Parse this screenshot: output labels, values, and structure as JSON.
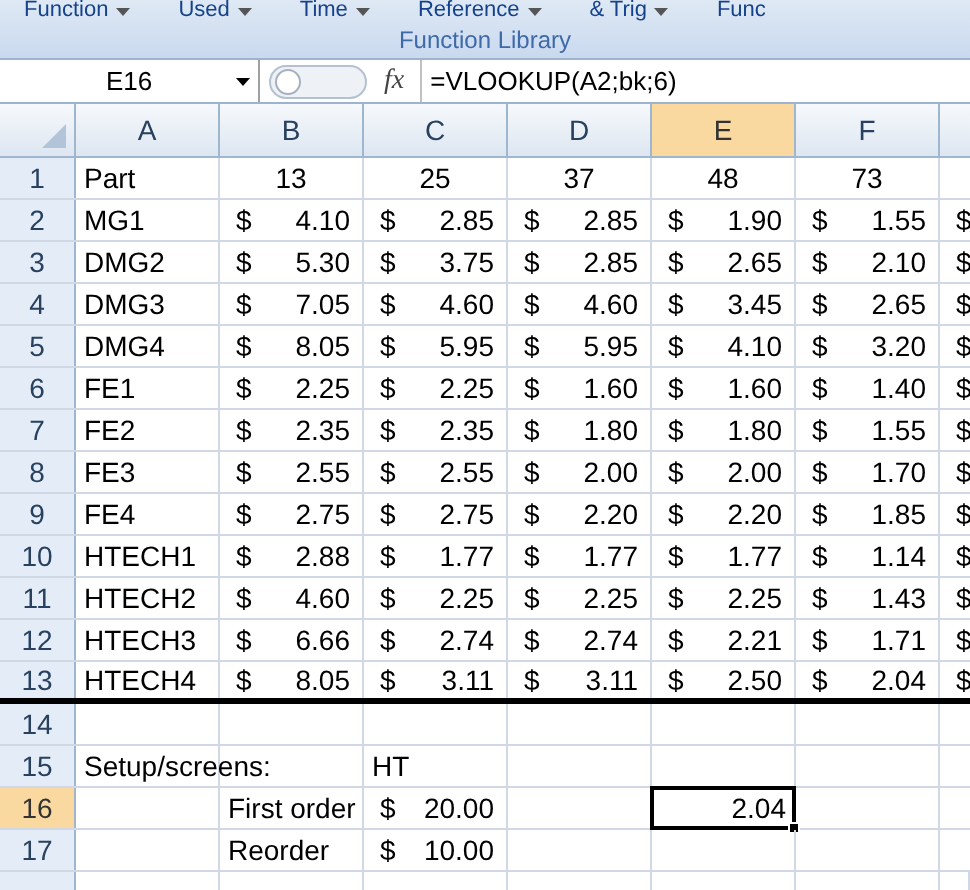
{
  "ribbon": {
    "buttons": [
      {
        "label": "Function",
        "dropdown": true
      },
      {
        "label": "Used",
        "dropdown": true
      },
      {
        "label": "Time",
        "dropdown": true
      },
      {
        "label": "Reference",
        "dropdown": true
      },
      {
        "label": "& Trig",
        "dropdown": true
      },
      {
        "label": "Func",
        "dropdown": false
      }
    ],
    "group_label": "Function Library"
  },
  "formula_bar": {
    "name_box": "E16",
    "fx": "fx",
    "formula": "=VLOOKUP(A2;bk;6)"
  },
  "columns": [
    {
      "label": "A",
      "selected": false
    },
    {
      "label": "B",
      "selected": false
    },
    {
      "label": "C",
      "selected": false
    },
    {
      "label": "D",
      "selected": false
    },
    {
      "label": "E",
      "selected": true
    },
    {
      "label": "F",
      "selected": false
    }
  ],
  "rows": [
    {
      "number": "1",
      "selected": false,
      "thick_bottom_border": false,
      "cells": [
        {
          "kind": "text",
          "text": "Part",
          "selected": false
        },
        {
          "kind": "center",
          "text": "13",
          "selected": false
        },
        {
          "kind": "center",
          "text": "25",
          "selected": false
        },
        {
          "kind": "center",
          "text": "37",
          "selected": false
        },
        {
          "kind": "center",
          "text": "48",
          "selected": false
        },
        {
          "kind": "center",
          "text": "73",
          "selected": false
        }
      ]
    },
    {
      "number": "2",
      "selected": false,
      "thick_bottom_border": false,
      "cells": [
        {
          "kind": "text",
          "text": "MG1",
          "selected": false
        },
        {
          "kind": "money",
          "symbol": "$",
          "amount": "4.10",
          "selected": false
        },
        {
          "kind": "money",
          "symbol": "$",
          "amount": "2.85",
          "selected": false
        },
        {
          "kind": "money",
          "symbol": "$",
          "amount": "2.85",
          "selected": false
        },
        {
          "kind": "money",
          "symbol": "$",
          "amount": "1.90",
          "selected": false
        },
        {
          "kind": "money",
          "symbol": "$",
          "amount": "1.55",
          "selected": false
        },
        {
          "kind": "money",
          "symbol": "$",
          "selected": false
        }
      ]
    },
    {
      "number": "3",
      "selected": false,
      "thick_bottom_border": false,
      "cells": [
        {
          "kind": "text",
          "text": "DMG2",
          "selected": false
        },
        {
          "kind": "money",
          "symbol": "$",
          "amount": "5.30",
          "selected": false
        },
        {
          "kind": "money",
          "symbol": "$",
          "amount": "3.75",
          "selected": false
        },
        {
          "kind": "money",
          "symbol": "$",
          "amount": "2.85",
          "selected": false
        },
        {
          "kind": "money",
          "symbol": "$",
          "amount": "2.65",
          "selected": false
        },
        {
          "kind": "money",
          "symbol": "$",
          "amount": "2.10",
          "selected": false
        },
        {
          "kind": "money",
          "symbol": "$",
          "selected": false
        }
      ]
    },
    {
      "number": "4",
      "selected": false,
      "thick_bottom_border": false,
      "cells": [
        {
          "kind": "text",
          "text": "DMG3",
          "selected": false
        },
        {
          "kind": "money",
          "symbol": "$",
          "amount": "7.05",
          "selected": false
        },
        {
          "kind": "money",
          "symbol": "$",
          "amount": "4.60",
          "selected": false
        },
        {
          "kind": "money",
          "symbol": "$",
          "amount": "4.60",
          "selected": false
        },
        {
          "kind": "money",
          "symbol": "$",
          "amount": "3.45",
          "selected": false
        },
        {
          "kind": "money",
          "symbol": "$",
          "amount": "2.65",
          "selected": false
        },
        {
          "kind": "money",
          "symbol": "$",
          "selected": false
        }
      ]
    },
    {
      "number": "5",
      "selected": false,
      "thick_bottom_border": false,
      "cells": [
        {
          "kind": "text",
          "text": "DMG4",
          "selected": false
        },
        {
          "kind": "money",
          "symbol": "$",
          "amount": "8.05",
          "selected": false
        },
        {
          "kind": "money",
          "symbol": "$",
          "amount": "5.95",
          "selected": false
        },
        {
          "kind": "money",
          "symbol": "$",
          "amount": "5.95",
          "selected": false
        },
        {
          "kind": "money",
          "symbol": "$",
          "amount": "4.10",
          "selected": false
        },
        {
          "kind": "money",
          "symbol": "$",
          "amount": "3.20",
          "selected": false
        },
        {
          "kind": "money",
          "symbol": "$",
          "selected": false
        }
      ]
    },
    {
      "number": "6",
      "selected": false,
      "thick_bottom_border": false,
      "cells": [
        {
          "kind": "text",
          "text": "FE1",
          "selected": false
        },
        {
          "kind": "money",
          "symbol": "$",
          "amount": "2.25",
          "selected": false
        },
        {
          "kind": "money",
          "symbol": "$",
          "amount": "2.25",
          "selected": false
        },
        {
          "kind": "money",
          "symbol": "$",
          "amount": "1.60",
          "selected": false
        },
        {
          "kind": "money",
          "symbol": "$",
          "amount": "1.60",
          "selected": false
        },
        {
          "kind": "money",
          "symbol": "$",
          "amount": "1.40",
          "selected": false
        },
        {
          "kind": "money",
          "symbol": "$",
          "selected": false
        }
      ]
    },
    {
      "number": "7",
      "selected": false,
      "thick_bottom_border": false,
      "cells": [
        {
          "kind": "text",
          "text": "FE2",
          "selected": false
        },
        {
          "kind": "money",
          "symbol": "$",
          "amount": "2.35",
          "selected": false
        },
        {
          "kind": "money",
          "symbol": "$",
          "amount": "2.35",
          "selected": false
        },
        {
          "kind": "money",
          "symbol": "$",
          "amount": "1.80",
          "selected": false
        },
        {
          "kind": "money",
          "symbol": "$",
          "amount": "1.80",
          "selected": false
        },
        {
          "kind": "money",
          "symbol": "$",
          "amount": "1.55",
          "selected": false
        },
        {
          "kind": "money",
          "symbol": "$",
          "selected": false
        }
      ]
    },
    {
      "number": "8",
      "selected": false,
      "thick_bottom_border": false,
      "cells": [
        {
          "kind": "text",
          "text": "FE3",
          "selected": false
        },
        {
          "kind": "money",
          "symbol": "$",
          "amount": "2.55",
          "selected": false
        },
        {
          "kind": "money",
          "symbol": "$",
          "amount": "2.55",
          "selected": false
        },
        {
          "kind": "money",
          "symbol": "$",
          "amount": "2.00",
          "selected": false
        },
        {
          "kind": "money",
          "symbol": "$",
          "amount": "2.00",
          "selected": false
        },
        {
          "kind": "money",
          "symbol": "$",
          "amount": "1.70",
          "selected": false
        },
        {
          "kind": "money",
          "symbol": "$",
          "selected": false
        }
      ]
    },
    {
      "number": "9",
      "selected": false,
      "thick_bottom_border": false,
      "cells": [
        {
          "kind": "text",
          "text": "FE4",
          "selected": false
        },
        {
          "kind": "money",
          "symbol": "$",
          "amount": "2.75",
          "selected": false
        },
        {
          "kind": "money",
          "symbol": "$",
          "amount": "2.75",
          "selected": false
        },
        {
          "kind": "money",
          "symbol": "$",
          "amount": "2.20",
          "selected": false
        },
        {
          "kind": "money",
          "symbol": "$",
          "amount": "2.20",
          "selected": false
        },
        {
          "kind": "money",
          "symbol": "$",
          "amount": "1.85",
          "selected": false
        },
        {
          "kind": "money",
          "symbol": "$",
          "selected": false
        }
      ]
    },
    {
      "number": "10",
      "selected": false,
      "thick_bottom_border": false,
      "cells": [
        {
          "kind": "text",
          "text": "HTECH1",
          "selected": false
        },
        {
          "kind": "money",
          "symbol": "$",
          "amount": "2.88",
          "selected": false
        },
        {
          "kind": "money",
          "symbol": "$",
          "amount": "1.77",
          "selected": false
        },
        {
          "kind": "money",
          "symbol": "$",
          "amount": "1.77",
          "selected": false
        },
        {
          "kind": "money",
          "symbol": "$",
          "amount": "1.77",
          "selected": false
        },
        {
          "kind": "money",
          "symbol": "$",
          "amount": "1.14",
          "selected": false
        },
        {
          "kind": "money",
          "symbol": "$",
          "selected": false
        }
      ]
    },
    {
      "number": "11",
      "selected": false,
      "thick_bottom_border": false,
      "cells": [
        {
          "kind": "text",
          "text": "HTECH2",
          "selected": false
        },
        {
          "kind": "money",
          "symbol": "$",
          "amount": "4.60",
          "selected": false
        },
        {
          "kind": "money",
          "symbol": "$",
          "amount": "2.25",
          "selected": false
        },
        {
          "kind": "money",
          "symbol": "$",
          "amount": "2.25",
          "selected": false
        },
        {
          "kind": "money",
          "symbol": "$",
          "amount": "2.25",
          "selected": false
        },
        {
          "kind": "money",
          "symbol": "$",
          "amount": "1.43",
          "selected": false
        },
        {
          "kind": "money",
          "symbol": "$",
          "selected": false
        }
      ]
    },
    {
      "number": "12",
      "selected": false,
      "thick_bottom_border": false,
      "cells": [
        {
          "kind": "text",
          "text": "HTECH3",
          "selected": false
        },
        {
          "kind": "money",
          "symbol": "$",
          "amount": "6.66",
          "selected": false
        },
        {
          "kind": "money",
          "symbol": "$",
          "amount": "2.74",
          "selected": false
        },
        {
          "kind": "money",
          "symbol": "$",
          "amount": "2.74",
          "selected": false
        },
        {
          "kind": "money",
          "symbol": "$",
          "amount": "2.21",
          "selected": false
        },
        {
          "kind": "money",
          "symbol": "$",
          "amount": "1.71",
          "selected": false
        },
        {
          "kind": "money",
          "symbol": "$",
          "selected": false
        }
      ]
    },
    {
      "number": "13",
      "selected": false,
      "thick_bottom_border": true,
      "cells": [
        {
          "kind": "text",
          "text": "HTECH4",
          "selected": false
        },
        {
          "kind": "money",
          "symbol": "$",
          "amount": "8.05",
          "selected": false
        },
        {
          "kind": "money",
          "symbol": "$",
          "amount": "3.11",
          "selected": false
        },
        {
          "kind": "money",
          "symbol": "$",
          "amount": "3.11",
          "selected": false
        },
        {
          "kind": "money",
          "symbol": "$",
          "amount": "2.50",
          "selected": false
        },
        {
          "kind": "money",
          "symbol": "$",
          "amount": "2.04",
          "selected": false
        },
        {
          "kind": "money",
          "symbol": "$",
          "selected": false
        }
      ]
    },
    {
      "number": "14",
      "selected": false,
      "thick_bottom_border": false,
      "cells": []
    },
    {
      "number": "15",
      "selected": false,
      "thick_bottom_border": false,
      "cells": [
        {
          "kind": "overflow",
          "text": "Setup/screens:",
          "selected": false
        },
        {
          "kind": "empty"
        },
        {
          "kind": "text",
          "text": "HT",
          "selected": false
        }
      ]
    },
    {
      "number": "16",
      "selected": true,
      "thick_bottom_border": false,
      "cells": [
        {
          "kind": "empty"
        },
        {
          "kind": "text",
          "text": "First order",
          "selected": false
        },
        {
          "kind": "money",
          "symbol": "$",
          "amount": "20.00",
          "selected": false
        },
        {
          "kind": "empty"
        },
        {
          "kind": "number",
          "text": "2.04",
          "selected": true
        }
      ]
    },
    {
      "number": "17",
      "selected": false,
      "thick_bottom_border": false,
      "cells": [
        {
          "kind": "empty"
        },
        {
          "kind": "text",
          "text": "Reorder",
          "selected": false
        },
        {
          "kind": "money",
          "symbol": "$",
          "amount": "10.00",
          "selected": false
        }
      ]
    }
  ]
}
